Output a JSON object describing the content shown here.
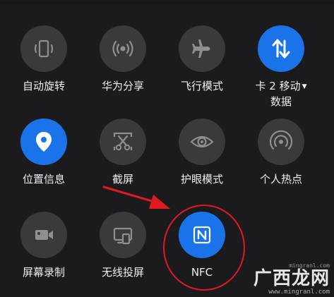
{
  "tiles": [
    {
      "id": "auto-rotate",
      "label": "自动旋转",
      "icon": "rotate-icon",
      "active": false
    },
    {
      "id": "huawei-share",
      "label": "华为分享",
      "icon": "share-signal-icon",
      "active": false
    },
    {
      "id": "airplane-mode",
      "label": "飞行模式",
      "icon": "airplane-icon",
      "active": false
    },
    {
      "id": "mobile-data",
      "label": "卡 2 移动",
      "label_line2": "数据",
      "icon": "data-arrows-icon",
      "active": true
    },
    {
      "id": "location",
      "label": "位置信息",
      "icon": "location-pin-icon",
      "active": true
    },
    {
      "id": "screenshot",
      "label": "截屏",
      "icon": "scissors-icon",
      "active": false
    },
    {
      "id": "eye-comfort",
      "label": "护眼模式",
      "icon": "eye-icon",
      "active": false
    },
    {
      "id": "hotspot",
      "label": "个人热点",
      "icon": "hotspot-icon",
      "active": false
    },
    {
      "id": "screen-record",
      "label": "屏幕录制",
      "icon": "video-camera-icon",
      "active": false
    },
    {
      "id": "wireless-projection",
      "label": "无线投屏",
      "icon": "cast-screen-icon",
      "active": false
    },
    {
      "id": "nfc",
      "label": "NFC",
      "icon": "nfc-icon",
      "active": true
    }
  ],
  "colors": {
    "active": "#1a73e8",
    "inactive": "#3a3a3c",
    "annotation": "#e0191f"
  },
  "watermark": {
    "top": "mingranl.com",
    "main": "广西龙网",
    "url": "www.mingranl.com"
  }
}
